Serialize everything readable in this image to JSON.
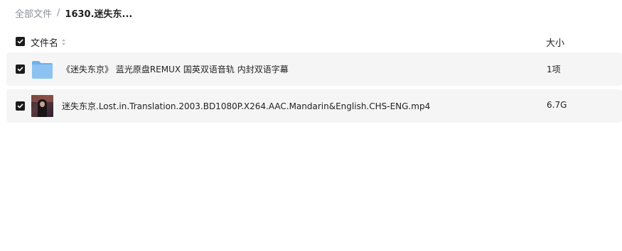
{
  "breadcrumb": {
    "root": "全部文件",
    "separator": "/",
    "current": "1630.迷失东..."
  },
  "header": {
    "name_label": "文件名",
    "size_label": "大小"
  },
  "files": [
    {
      "type": "folder",
      "icon": "folder-icon",
      "name": "《迷失东京》 蓝光原盘REMUX 国英双语音轨 内封双语字幕",
      "size": "1项",
      "checked": true
    },
    {
      "type": "video",
      "icon": "video-thumbnail",
      "name": "迷失东京.Lost.in.Translation.2003.BD1080P.X264.AAC.Mandarin&English.CHS-ENG.mp4",
      "size": "6.7G",
      "checked": true
    }
  ],
  "colors": {
    "row_background": "#f5f5f6",
    "checkbox": "#1c1c1c",
    "folder": "#8cc3f2",
    "muted_text": "#8a8f99"
  }
}
